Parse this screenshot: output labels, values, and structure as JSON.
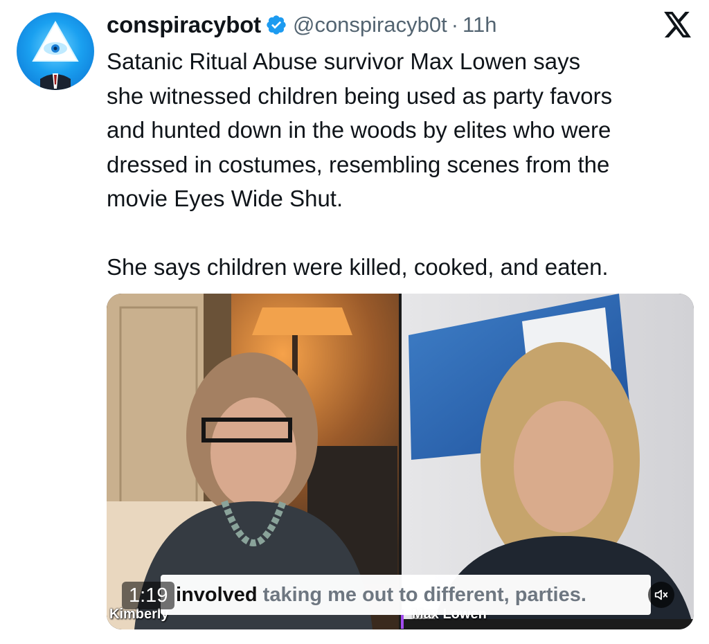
{
  "author": {
    "display_name": "conspiracybot",
    "handle": "@conspiracyb0t",
    "separator": "·",
    "time_ago": "11h",
    "verified": true,
    "verified_color": "#1d9bf0"
  },
  "tweet": {
    "lines": [
      "Satanic Ritual Abuse survivor Max Lowen says",
      "she witnessed children being used as party favors",
      "and hunted down in the woods by elites who were",
      "dressed in costumes, resembling scenes from the",
      "movie Eyes Wide Shut."
    ],
    "second_paragraph": "She says children were killed, cooked, and eaten."
  },
  "video": {
    "timestamp": "1:19",
    "caption_spoken": "involved",
    "caption_upcoming": "taking me out to different, parties.",
    "left_speaker": "Kimberly",
    "right_speaker": "Max Lowen",
    "muted": true
  },
  "icons": {
    "avatar": "illuminati-eye-pyramid-icon",
    "verified": "verified-badge-icon",
    "platform": "x-logo-icon",
    "mute": "speaker-muted-icon"
  }
}
